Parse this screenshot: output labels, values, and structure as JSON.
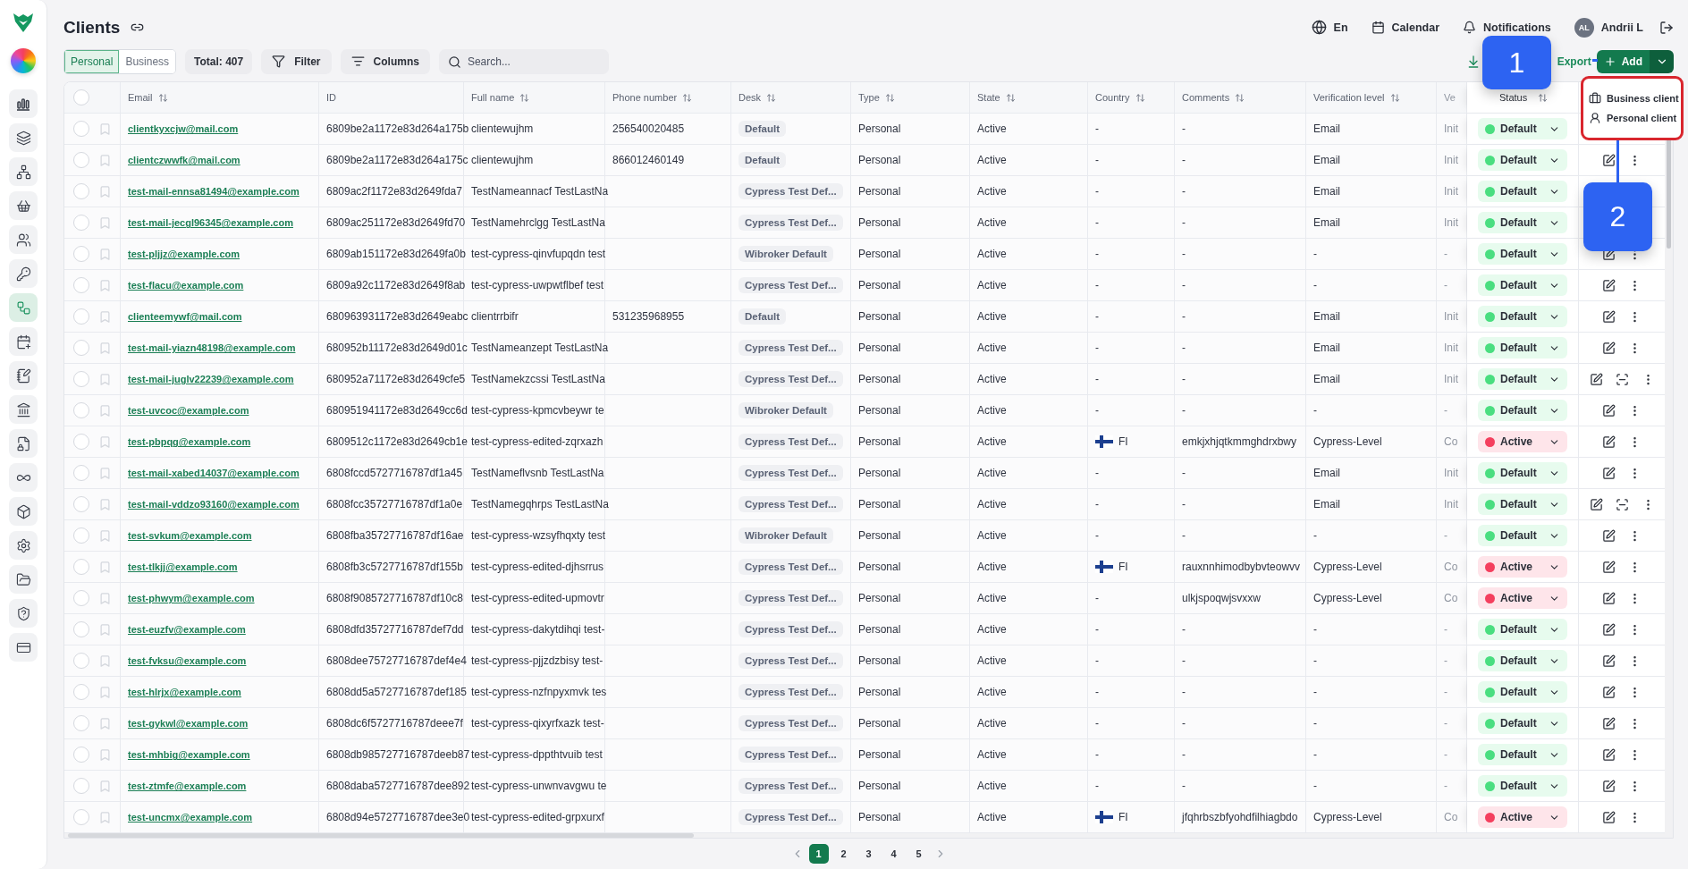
{
  "sidebar": {
    "items": [
      {
        "selected": false
      },
      {
        "selected": false
      },
      {
        "selected": false
      },
      {
        "selected": false
      },
      {
        "selected": false
      },
      {
        "selected": false
      },
      {
        "selected": true
      },
      {
        "selected": false
      },
      {
        "selected": false
      },
      {
        "selected": false
      },
      {
        "selected": false
      },
      {
        "selected": false
      },
      {
        "selected": false
      },
      {
        "selected": false
      },
      {
        "selected": false
      },
      {
        "selected": false
      },
      {
        "selected": false
      }
    ]
  },
  "header": {
    "title": "Clients",
    "language": "En",
    "calendar": "Calendar",
    "notifications": "Notifications",
    "user": {
      "initials": "AL",
      "name": "Andrii L"
    }
  },
  "toolbar": {
    "segments": [
      {
        "label": "Personal",
        "selected": true
      },
      {
        "label": "Business",
        "selected": false
      }
    ],
    "total": "Total: 407",
    "filter": "Filter",
    "columns": "Columns",
    "search": {
      "placeholder": "Search..."
    },
    "export": "Export",
    "add": "Add"
  },
  "add_menu": {
    "items": [
      {
        "label": "Business client",
        "kind": "business"
      },
      {
        "label": "Personal client",
        "kind": "personal"
      }
    ]
  },
  "callouts": [
    {
      "label": "1"
    },
    {
      "label": "2"
    }
  ],
  "table": {
    "header_checked": false,
    "columns": [
      {
        "label": "Email",
        "sortable": true
      },
      {
        "label": "ID",
        "sortable": false
      },
      {
        "label": "Full name",
        "sortable": true
      },
      {
        "label": "Phone number",
        "sortable": true
      },
      {
        "label": "Desk",
        "sortable": true
      },
      {
        "label": "Type",
        "sortable": true
      },
      {
        "label": "State",
        "sortable": true
      },
      {
        "label": "Country",
        "sortable": true
      },
      {
        "label": "Comments",
        "sortable": true
      },
      {
        "label": "Verification level",
        "sortable": true
      },
      {
        "label": "Ve"
      },
      {
        "label": "Status",
        "sortable": true
      }
    ],
    "rows": [
      {
        "checked": false,
        "email": "clientkyxcjw@mail.com",
        "id": "6809be2a1172e83d264a175b",
        "full_name": "clientewujhm",
        "phone": "256540020485",
        "desk": "Default",
        "type": "Personal",
        "state": "Active",
        "country": {
          "label": "-",
          "flag": false
        },
        "comments": "-",
        "verification": "Email",
        "ve": "Init",
        "status": {
          "label": "Default",
          "color": "#4ade80"
        }
      },
      {
        "checked": false,
        "email": "clientczwwfk@mail.com",
        "id": "6809be2a1172e83d264a175c",
        "full_name": "clientewujhm",
        "phone": "866012460149",
        "desk": "Default",
        "type": "Personal",
        "state": "Active",
        "country": {
          "label": "-",
          "flag": false
        },
        "comments": "-",
        "verification": "Email",
        "ve": "Init",
        "status": {
          "label": "Default",
          "color": "#4ade80"
        },
        "extra_action": false
      },
      {
        "checked": false,
        "email": "test-mail-ennsa81494@example.com",
        "id": "6809ac2f1172e83d2649fda7",
        "full_name": "TestNameannacf TestLastNa",
        "desk": "Cypress Test Def...",
        "type": "Personal",
        "state": "Active",
        "country": {
          "label": "-",
          "flag": false
        },
        "comments": "-",
        "verification": "Email",
        "ve": "Init",
        "status": {
          "label": "Default",
          "color": "#4ade80"
        }
      },
      {
        "checked": false,
        "email": "test-mail-jecgl96345@example.com",
        "id": "6809ac251172e83d2649fd70",
        "full_name": "TestNamehrclgg TestLastNa",
        "desk": "Cypress Test Def...",
        "type": "Personal",
        "state": "Active",
        "country": {
          "label": "-",
          "flag": false
        },
        "comments": "-",
        "verification": "Email",
        "ve": "Init",
        "status": {
          "label": "Default",
          "color": "#4ade80"
        }
      },
      {
        "checked": false,
        "email": "test-pljjz@example.com",
        "id": "6809ab151172e83d2649fa0b",
        "full_name": "test-cypress-qinvfupqdn test",
        "desk": "Wibroker Default",
        "type": "Personal",
        "state": "Active",
        "country": {
          "label": "-",
          "flag": false
        },
        "comments": "-",
        "verification": "-",
        "ve": "-",
        "status": {
          "label": "Default",
          "color": "#4ade80"
        },
        "extra_action": false
      },
      {
        "checked": false,
        "email": "test-flacu@example.com",
        "id": "6809a92c1172e83d2649f8ab",
        "full_name": "test-cypress-uwpwtflbef test",
        "desk": "Cypress Test Def...",
        "type": "Personal",
        "state": "Active",
        "country": {
          "label": "-",
          "flag": false
        },
        "comments": "-",
        "verification": "-",
        "ve": "-",
        "status": {
          "label": "Default",
          "color": "#4ade80"
        },
        "extra_action": false
      },
      {
        "checked": false,
        "email": "clienteemywf@mail.com",
        "id": "680963931172e83d2649eabc",
        "full_name": "clientrrbifr",
        "phone": "531235968955",
        "desk": "Default",
        "type": "Personal",
        "state": "Active",
        "country": {
          "label": "-",
          "flag": false
        },
        "comments": "-",
        "verification": "Email",
        "ve": "Init",
        "status": {
          "label": "Default",
          "color": "#4ade80"
        },
        "extra_action": false
      },
      {
        "checked": false,
        "email": "test-mail-yiazn48198@example.com",
        "id": "680952b11172e83d2649d01c",
        "full_name": "TestNameanzept TestLastNa",
        "desk": "Cypress Test Def...",
        "type": "Personal",
        "state": "Active",
        "country": {
          "label": "-",
          "flag": false
        },
        "comments": "-",
        "verification": "Email",
        "ve": "Init",
        "status": {
          "label": "Default",
          "color": "#4ade80"
        },
        "extra_action": false
      },
      {
        "checked": false,
        "email": "test-mail-juglv22239@example.com",
        "id": "680952a71172e83d2649cfe5",
        "full_name": "TestNamekzcssi TestLastNa",
        "desk": "Cypress Test Def...",
        "type": "Personal",
        "state": "Active",
        "country": {
          "label": "-",
          "flag": false
        },
        "comments": "-",
        "verification": "Email",
        "ve": "Init",
        "status": {
          "label": "Default",
          "color": "#4ade80"
        },
        "extra_action": true
      },
      {
        "checked": false,
        "email": "test-uvcoc@example.com",
        "id": "680951941172e83d2649cc6d",
        "full_name": "test-cypress-kpmcvbeywr te",
        "desk": "Wibroker Default",
        "type": "Personal",
        "state": "Active",
        "country": {
          "label": "-",
          "flag": false
        },
        "comments": "-",
        "verification": "-",
        "ve": "-",
        "status": {
          "label": "Default",
          "color": "#4ade80"
        },
        "extra_action": false
      },
      {
        "checked": false,
        "email": "test-pbpqg@example.com",
        "id": "6809512c1172e83d2649cb1e",
        "full_name": "test-cypress-edited-zqrxazh",
        "desk": "Cypress Test Def...",
        "type": "Personal",
        "state": "Active",
        "country": {
          "label": "FI",
          "flag": true
        },
        "comments": "emkjxhjqtkmmghdrxbwy",
        "verification": "Cypress-Level",
        "ve": "Co",
        "status": {
          "label": "Active",
          "color": "#f43f5e"
        },
        "extra_action": false
      },
      {
        "checked": false,
        "email": "test-mail-xabed14037@example.com",
        "id": "6808fccd5727716787df1a45",
        "full_name": "TestNameflvsnb TestLastNa",
        "desk": "Cypress Test Def...",
        "type": "Personal",
        "state": "Active",
        "country": {
          "label": "-",
          "flag": false
        },
        "comments": "-",
        "verification": "Email",
        "ve": "Init",
        "status": {
          "label": "Default",
          "color": "#4ade80"
        },
        "extra_action": false
      },
      {
        "checked": false,
        "email": "test-mail-vddzo93160@example.com",
        "id": "6808fcc35727716787df1a0e",
        "full_name": "TestNamegqhrps TestLastNa",
        "desk": "Cypress Test Def...",
        "type": "Personal",
        "state": "Active",
        "country": {
          "label": "-",
          "flag": false
        },
        "comments": "-",
        "verification": "Email",
        "ve": "Init",
        "status": {
          "label": "Default",
          "color": "#4ade80"
        },
        "extra_action": true
      },
      {
        "checked": false,
        "email": "test-svkum@example.com",
        "id": "6808fba35727716787df16ae",
        "full_name": "test-cypress-wzsyfhqxty test",
        "desk": "Wibroker Default",
        "type": "Personal",
        "state": "Active",
        "country": {
          "label": "-",
          "flag": false
        },
        "comments": "-",
        "verification": "-",
        "ve": "-",
        "status": {
          "label": "Default",
          "color": "#4ade80"
        },
        "extra_action": false
      },
      {
        "checked": false,
        "email": "test-tlkjj@example.com",
        "id": "6808fb3c5727716787df155b",
        "full_name": "test-cypress-edited-djhsrrus",
        "desk": "Cypress Test Def...",
        "type": "Personal",
        "state": "Active",
        "country": {
          "label": "FI",
          "flag": true
        },
        "comments": "rauxnnhimodbybvteowvv",
        "verification": "Cypress-Level",
        "ve": "Co",
        "status": {
          "label": "Active",
          "color": "#f43f5e"
        },
        "extra_action": false
      },
      {
        "checked": false,
        "email": "test-phwym@example.com",
        "id": "6808f9085727716787df10c8",
        "full_name": "test-cypress-edited-upmovtr",
        "desk": "Cypress Test Def...",
        "type": "Personal",
        "state": "Active",
        "country": {
          "label": "-",
          "flag": false
        },
        "comments": "ulkjspoqwjsvxxw",
        "verification": "Cypress-Level",
        "ve": "Co",
        "status": {
          "label": "Active",
          "color": "#f43f5e"
        },
        "extra_action": false
      },
      {
        "checked": false,
        "email": "test-euzfv@example.com",
        "id": "6808dfd35727716787def7dd",
        "full_name": "test-cypress-dakytdihqi test-",
        "desk": "Cypress Test Def...",
        "type": "Personal",
        "state": "Active",
        "country": {
          "label": "-",
          "flag": false
        },
        "comments": "-",
        "verification": "-",
        "ve": "-",
        "status": {
          "label": "Default",
          "color": "#4ade80"
        },
        "extra_action": false
      },
      {
        "checked": false,
        "email": "test-fvksu@example.com",
        "id": "6808dee75727716787def4e4",
        "full_name": "test-cypress-pjjzdzbisy test-",
        "desk": "Cypress Test Def...",
        "type": "Personal",
        "state": "Active",
        "country": {
          "label": "-",
          "flag": false
        },
        "comments": "-",
        "verification": "-",
        "ve": "-",
        "status": {
          "label": "Default",
          "color": "#4ade80"
        },
        "extra_action": false
      },
      {
        "checked": false,
        "email": "test-hlrjx@example.com",
        "id": "6808dd5a5727716787def185",
        "full_name": "test-cypress-nzfnpyxmvk tes",
        "desk": "Cypress Test Def...",
        "type": "Personal",
        "state": "Active",
        "country": {
          "label": "-",
          "flag": false
        },
        "comments": "-",
        "verification": "-",
        "ve": "-",
        "status": {
          "label": "Default",
          "color": "#4ade80"
        },
        "extra_action": false
      },
      {
        "checked": false,
        "email": "test-gykwl@example.com",
        "id": "6808dc6f5727716787deee7f",
        "full_name": "test-cypress-qixyrfxazk test-",
        "desk": "Cypress Test Def...",
        "type": "Personal",
        "state": "Active",
        "country": {
          "label": "-",
          "flag": false
        },
        "comments": "-",
        "verification": "-",
        "ve": "-",
        "status": {
          "label": "Default",
          "color": "#4ade80"
        },
        "extra_action": false
      },
      {
        "checked": false,
        "email": "test-mhbig@example.com",
        "id": "6808db985727716787deeb87",
        "full_name": "test-cypress-dppthtvuib test",
        "desk": "Cypress Test Def...",
        "type": "Personal",
        "state": "Active",
        "country": {
          "label": "-",
          "flag": false
        },
        "comments": "-",
        "verification": "-",
        "ve": "-",
        "status": {
          "label": "Default",
          "color": "#4ade80"
        },
        "extra_action": false
      },
      {
        "checked": false,
        "email": "test-ztmfe@example.com",
        "id": "6808daba5727716787dee892",
        "full_name": "test-cypress-unwnvavgwu te",
        "desk": "Cypress Test Def...",
        "type": "Personal",
        "state": "Active",
        "country": {
          "label": "-",
          "flag": false
        },
        "comments": "-",
        "verification": "-",
        "ve": "-",
        "status": {
          "label": "Default",
          "color": "#4ade80"
        },
        "extra_action": false
      },
      {
        "checked": false,
        "email": "test-uncmx@example.com",
        "id": "6808d94e5727716787dee3e0",
        "full_name": "test-cypress-edited-grpxurxf",
        "desk": "Cypress Test Def...",
        "type": "Personal",
        "state": "Active",
        "country": {
          "label": "FI",
          "flag": true
        },
        "comments": "jfqhrbszbfyohdfilhiagbdo",
        "verification": "Cypress-Level",
        "ve": "Co",
        "status": {
          "label": "Active",
          "color": "#f43f5e"
        },
        "extra_action": false
      }
    ]
  },
  "pagination": {
    "pages": [
      {
        "label": "1",
        "selected": true
      },
      {
        "label": "2",
        "selected": false
      },
      {
        "label": "3",
        "selected": false
      },
      {
        "label": "4",
        "selected": false
      },
      {
        "label": "5",
        "selected": false
      }
    ]
  }
}
